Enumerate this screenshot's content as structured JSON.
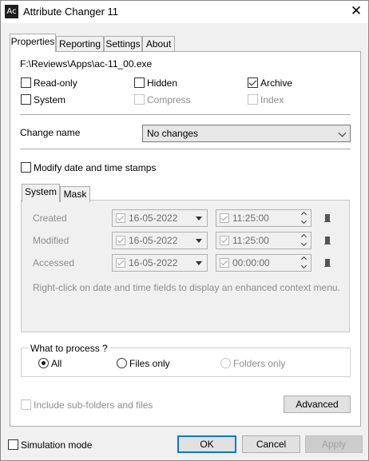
{
  "window": {
    "title": "Attribute Changer 11",
    "icon_text": "Ac",
    "close_glyph": "✕"
  },
  "tabs": [
    {
      "label": "Properties",
      "active": true
    },
    {
      "label": "Reporting",
      "active": false
    },
    {
      "label": "Settings",
      "active": false
    },
    {
      "label": "About",
      "active": false
    }
  ],
  "file_path": "F:\\Reviews\\Apps\\ac-11_00.exe",
  "attributes": {
    "read_only": {
      "label": "Read-only",
      "checked": false
    },
    "hidden": {
      "label": "Hidden",
      "checked": false
    },
    "archive": {
      "label": "Archive",
      "checked": true
    },
    "system": {
      "label": "System",
      "checked": false
    },
    "compress": {
      "label": "Compress",
      "checked": false,
      "disabled": true
    },
    "index": {
      "label": "Index",
      "checked": false,
      "disabled": true
    }
  },
  "change_name": {
    "label": "Change name",
    "value": "No changes"
  },
  "modify_stamps": {
    "label": "Modify date and time stamps",
    "checked": false
  },
  "inner_tabs": [
    {
      "label": "System",
      "active": true
    },
    {
      "label": "Mask",
      "active": false
    }
  ],
  "timestamps": {
    "created": {
      "label": "Created",
      "date": "16-05-2022",
      "time": "11:25:00"
    },
    "modified": {
      "label": "Modified",
      "date": "16-05-2022",
      "time": "11:25:00"
    },
    "accessed": {
      "label": "Accessed",
      "date": "16-05-2022",
      "time": "00:00:00"
    }
  },
  "hint": "Right-click on date and time fields to display an enhanced context menu.",
  "what_to_process": {
    "legend": "What to process ?",
    "options": [
      {
        "label": "All",
        "selected": true,
        "disabled": false
      },
      {
        "label": "Files only",
        "selected": false,
        "disabled": false
      },
      {
        "label": "Folders only",
        "selected": false,
        "disabled": true
      }
    ]
  },
  "include_subfolders": {
    "label": "Include sub-folders and files",
    "checked": false,
    "disabled": true
  },
  "buttons": {
    "advanced": "Advanced",
    "ok": "OK",
    "cancel": "Cancel",
    "apply": "Apply"
  },
  "simulation_mode": {
    "label": "Simulation mode",
    "checked": false
  },
  "colors": {
    "accent": "#0078d7",
    "window_bg": "#f0f0f0",
    "disabled_text": "#8d8d8d"
  }
}
